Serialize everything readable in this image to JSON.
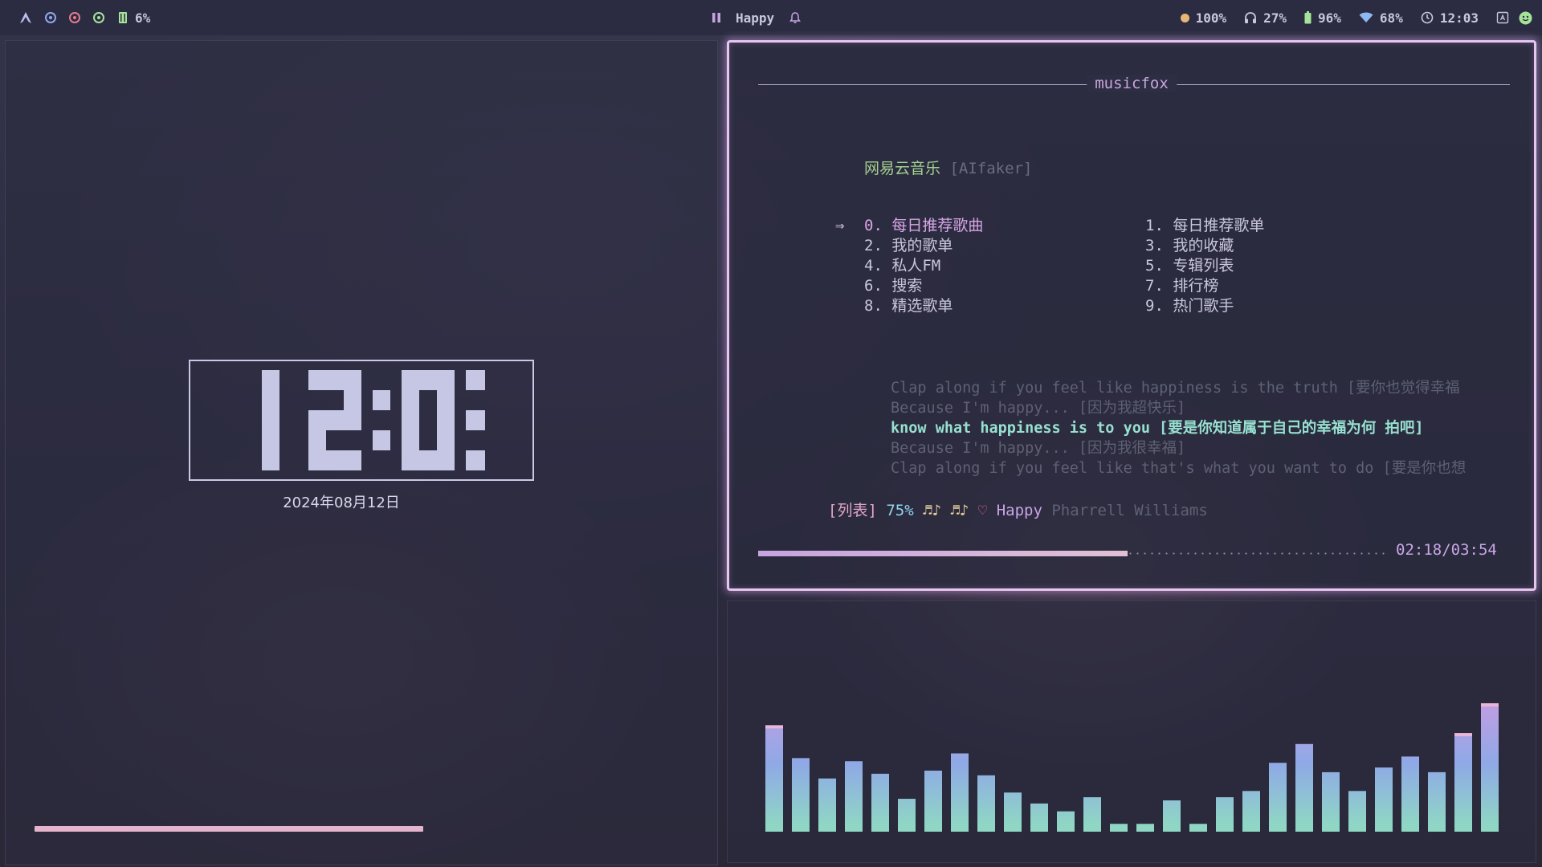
{
  "topbar": {
    "left": {
      "workspace_indicator": "6%",
      "workspace_icons": [
        "dot-circle-icon",
        "workspace-2-icon",
        "workspace-3-icon"
      ]
    },
    "center": {
      "track": "Happy"
    },
    "right": {
      "brightness": "100%",
      "headphones": "27%",
      "battery": "96%",
      "wifi": "68%",
      "clock": "12:03"
    },
    "colors": {
      "accent": "#c5a4e0",
      "brightness_dot": "#e6b676",
      "battery": "#a6e39a",
      "wifi": "#8fb7f2"
    }
  },
  "clock": {
    "time": "12:03",
    "date": "2024年08月12日"
  },
  "player": {
    "title": "musicfox",
    "app_name": "网易云音乐",
    "user": "[AIfaker]",
    "selected_index": 0,
    "menu": [
      "0. 每日推荐歌曲",
      "1. 每日推荐歌单",
      "2. 我的歌单",
      "3. 我的收藏",
      "4. 私人FM",
      "5. 专辑列表",
      "6. 搜索",
      "7. 排行榜",
      "8. 精选歌单",
      "9. 热门歌手"
    ],
    "lyrics": [
      "Clap along if you feel like happiness is the truth [要你也觉得幸福",
      "Because I'm happy... [因为我超快乐]",
      " know what happiness is to you [要是你知道属于自己的幸福为何 拍吧]",
      "Because I'm happy... [因为我很幸福]",
      "Clap along if you feel like that's what you want to do [要是你也想"
    ],
    "current_lyric_index": 2,
    "status": {
      "mode": "[列表]",
      "volume": "75%",
      "notes": "♬♪ ♬♪",
      "heart": "♡",
      "song": "Happy",
      "artist": "Pharrell Williams"
    },
    "time": "02:18/03:54",
    "progress": 0.59
  },
  "left_progress": 0.5,
  "visualizer": {
    "levels": [
      0.68,
      0.47,
      0.34,
      0.45,
      0.37,
      0.21,
      0.39,
      0.5,
      0.36,
      0.25,
      0.18,
      0.13,
      0.22,
      0.05,
      0.05,
      0.2,
      0.05,
      0.22,
      0.26,
      0.44,
      0.56,
      0.38,
      0.26,
      0.41,
      0.48,
      0.38,
      0.63,
      0.82
    ]
  }
}
